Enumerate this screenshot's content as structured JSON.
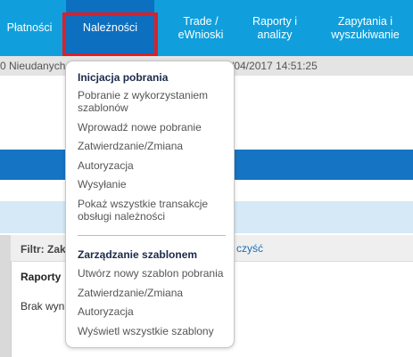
{
  "nav": {
    "items": [
      {
        "label": "Płatności"
      },
      {
        "label": "Należności"
      },
      {
        "label": "Trade / eWnioski"
      },
      {
        "label": "Raporty i analizy"
      },
      {
        "label": "Zapytania i wyszukiwanie"
      }
    ],
    "active": "Należności"
  },
  "status": {
    "left_text": "0 Nieudanych",
    "right_text": "/04/2017 14:51:25"
  },
  "dropdown": {
    "sections": [
      {
        "heading": "Inicjacja pobrania",
        "items": [
          "Pobranie z wykorzystaniem szablonów",
          "Wprowadź nowe pobranie",
          "Zatwierdzanie/Zmiana",
          "Autoryzacja",
          "Wysyłanie",
          "Pokaż wszystkie transakcje obsługi należności"
        ]
      },
      {
        "heading": "Zarządzanie szablonem",
        "items": [
          "Utwórz nowy szablon pobrania",
          "Zatwierdzanie/Zmiana",
          "Autoryzacja",
          "Wyświetl wszystkie szablony"
        ]
      }
    ]
  },
  "content": {
    "filter_label": "Filtr: Zakr",
    "clear_link": "czyść",
    "reports_heading": "Raporty",
    "no_results": "Brak wyni"
  },
  "colors": {
    "nav_bg": "#109fdc",
    "nav_active": "#0d6fbf",
    "highlight_outline": "#dd1f26",
    "band_dark": "#1574c3",
    "band_light": "#d5e9f7"
  }
}
